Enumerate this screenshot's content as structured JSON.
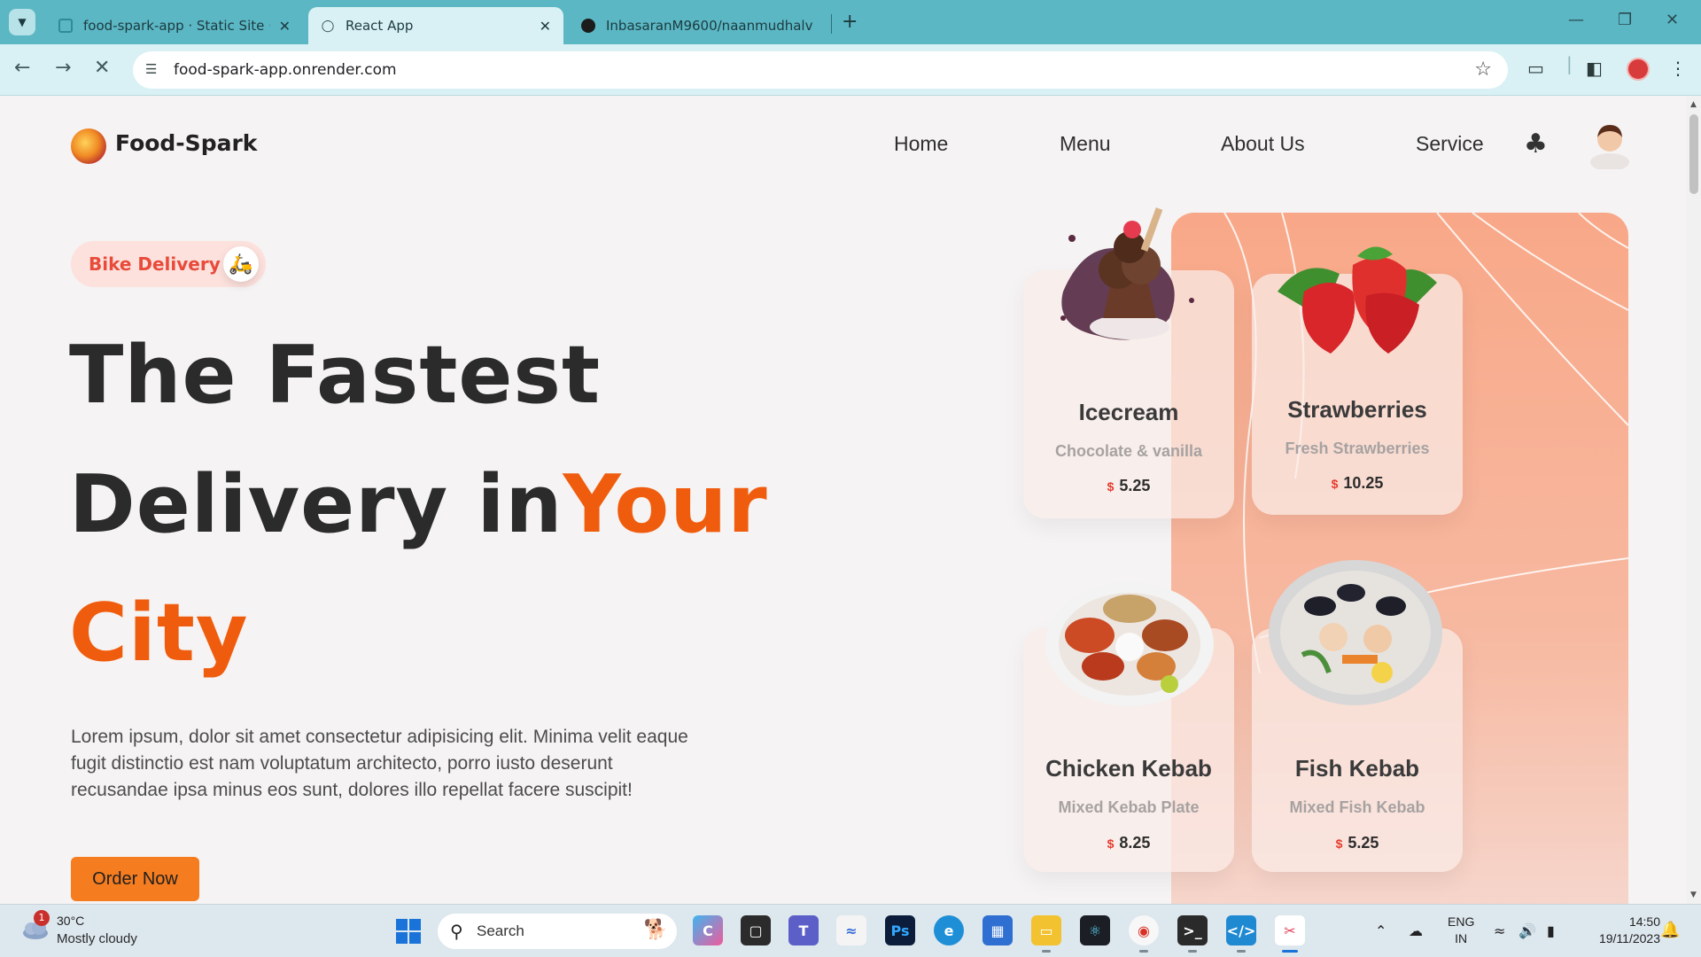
{
  "browser": {
    "tabs": [
      {
        "title": "food-spark-app · Static Site · R",
        "active": false
      },
      {
        "title": "React App",
        "active": true
      },
      {
        "title": "InbasaranM9600/naanmudhalv",
        "active": false
      }
    ],
    "url": "food-spark-app.onrender.com"
  },
  "site": {
    "brand": "Food-Spark",
    "nav": [
      "Home",
      "Menu",
      "About Us",
      "Service"
    ],
    "badge": "Bike Delivery",
    "hero": {
      "line1": "The Fastest",
      "line2_plain": "Delivery in",
      "line2_accent": "Your",
      "line3_accent": "City"
    },
    "description": "Lorem ipsum, dolor sit amet consectetur adipisicing elit. Minima velit eaque fugit distinctio est nam voluptatum architecto, porro iusto deserunt recusandae ipsa minus eos sunt, dolores illo repellat facere suscipit!",
    "cta": "Order Now",
    "currency": "$",
    "cards": [
      {
        "name": "Icecream",
        "subtitle": "Chocolate & vanilla",
        "price": "5.25"
      },
      {
        "name": "Strawberries",
        "subtitle": "Fresh Strawberries",
        "price": "10.25"
      },
      {
        "name": "Chicken Kebab",
        "subtitle": "Mixed Kebab Plate",
        "price": "8.25"
      },
      {
        "name": "Fish Kebab",
        "subtitle": "Mixed Fish Kebab",
        "price": "5.25"
      }
    ]
  },
  "taskbar": {
    "weather_temp": "30°C",
    "weather_desc": "Mostly cloudy",
    "weather_badge": "1",
    "search_label": "Search",
    "lang_line1": "ENG",
    "lang_line2": "IN",
    "time": "14:50",
    "date": "19/11/2023"
  },
  "colors": {
    "accent": "#f05c0d",
    "cta": "#f57c1f",
    "peach_panel": "#f8a888",
    "chrome": "#5bb7c4"
  }
}
